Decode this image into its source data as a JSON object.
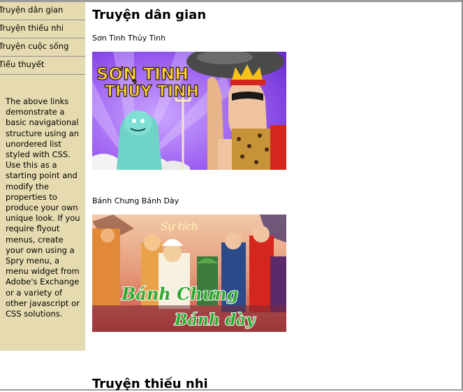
{
  "nav": [
    {
      "label": "Truyện dân gian"
    },
    {
      "label": "Truyện thiếu nhi"
    },
    {
      "label": "Truyện cuộc sống"
    },
    {
      "label": "Tiểu thuyết"
    }
  ],
  "sidebar_text": "The above links demonstrate a basic navigational structure using an unordered list styled with CSS. Use this as a starting point and modify the properties to produce your own unique look. If you require flyout menus, create your own using a Spry menu, a menu widget from Adobe's Exchange or a variety of other javascript or CSS solutions.",
  "section1": {
    "heading": "Truyện dân gian",
    "story1": {
      "caption": "Sơn Tinh Thủy Tinh",
      "banner_text_line1": "SƠN TINH",
      "banner_text_line2": "THỦY TINH"
    },
    "story2": {
      "caption": "Bánh Chưng Bánh Dày",
      "banner_top": "Sự tích",
      "banner_line1": "Bánh Chưng",
      "banner_line2": "Bánh dày"
    }
  },
  "section2": {
    "heading": "Truyện thiếu nhi"
  }
}
